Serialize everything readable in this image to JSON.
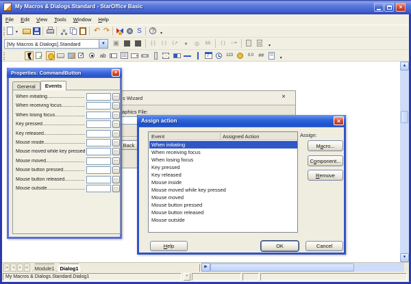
{
  "window": {
    "title": "My Macros & Dialogs.Standard - StarOffice Basic"
  },
  "menu_bar": {
    "items": [
      "File",
      "Edit",
      "View",
      "Tools",
      "Window",
      "Help"
    ]
  },
  "toolbars": {
    "standard": {
      "icons": [
        "new-document",
        "open",
        "save",
        "sep",
        "print",
        "sep",
        "cut",
        "copy",
        "paste",
        "sep",
        "undo",
        "redo",
        "sep",
        "navigator",
        "gear",
        "starbasic",
        "sep",
        "help",
        "overflow"
      ]
    },
    "macro": {
      "library_combo": "[My Macros & Dialogs].Standard",
      "icons": [
        "compile",
        "run",
        "stop",
        "sep",
        "step-into",
        "step-over",
        "step-out",
        "breakpoint",
        "breakpoints",
        "watch",
        "sep",
        "find-parentheses",
        "insert-source",
        "sep",
        "modules",
        "objects",
        "overflow"
      ]
    },
    "controls": {
      "icons": [
        "select",
        "test-mode",
        "language",
        "button",
        "image-control",
        "checkbox",
        "option-button",
        "label-field",
        "text-box",
        "list-box",
        "combo-box",
        "horizontal-scrollbar",
        "vertical-scrollbar",
        "group-box",
        "progress-bar",
        "horizontal-line",
        "vertical-line",
        "date-field",
        "time-field",
        "numeric-field",
        "currency-field",
        "formatted-field",
        "pattern-field",
        "file-selection",
        "overflow"
      ]
    }
  },
  "events": [
    "When initiating",
    "When receiving focus",
    "When losing focus",
    "Key pressed",
    "Key released",
    "Mouse inside",
    "Mouse moved while key pressed",
    "Mouse moved",
    "Mouse button pressed",
    "Mouse button released",
    "Mouse outside"
  ],
  "properties_dialog": {
    "title": "Properties: CommandButton",
    "tabs": [
      "General",
      "Events"
    ],
    "active_tab": "Events",
    "browse_label": "...",
    "field_value": ""
  },
  "wizard_window": {
    "title_visible": "s Wizard",
    "label_visible": "aphics File:",
    "back_label": "Back",
    "close_glyph": "×"
  },
  "assign_dialog": {
    "title": "Assign action",
    "columns": [
      "Event",
      "Assigned Action"
    ],
    "selected_event": "When initiating",
    "assign_label": "Assign:",
    "macro_label": "Macro...",
    "component_label": "Component...",
    "remove_label": "Remove",
    "help_label": "Help",
    "ok_label": "OK",
    "cancel_label": "Cancel",
    "mnemonic_index": {
      "macro": 1,
      "component": 1,
      "remove": 0,
      "help": 0
    }
  },
  "document_tabs": {
    "items": [
      "Module1",
      "Dialog1"
    ],
    "active": "Dialog1"
  },
  "status_bar": {
    "text": "My Macros & Dialogs.Standard.Dialog1",
    "modified_indicator": "*"
  }
}
